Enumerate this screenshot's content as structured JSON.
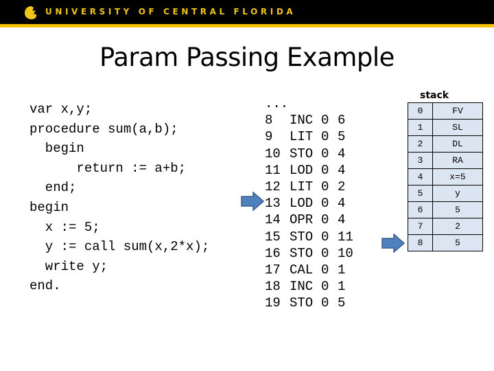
{
  "header": {
    "brand": "UNIVERSITY OF CENTRAL FLORIDA",
    "logo_icon": "pegasus-logo-icon",
    "colors": {
      "bar": "#000000",
      "stripe": "#f5c400",
      "text": "#f0c419"
    }
  },
  "slide": {
    "title": "Param Passing Example"
  },
  "source_code": [
    "var x,y;",
    "procedure sum(a,b);",
    "  begin",
    "      return := a+b;",
    "  end;",
    "begin",
    "  x := 5;",
    "  y := call sum(x,2*x);",
    "  write y;",
    "end."
  ],
  "instructions": {
    "ellipsis": "...",
    "rows": [
      {
        "line": "8",
        "op": "INC",
        "l": "0",
        "m": "6"
      },
      {
        "line": "9",
        "op": "LIT",
        "l": "0",
        "m": "5"
      },
      {
        "line": "10",
        "op": "STO",
        "l": "0",
        "m": "4"
      },
      {
        "line": "11",
        "op": "LOD",
        "l": "0",
        "m": "4"
      },
      {
        "line": "12",
        "op": "LIT",
        "l": "0",
        "m": "2"
      },
      {
        "line": "13",
        "op": "LOD",
        "l": "0",
        "m": "4"
      },
      {
        "line": "14",
        "op": "OPR",
        "l": "0",
        "m": "4"
      },
      {
        "line": "15",
        "op": "STO",
        "l": "0",
        "m": "11"
      },
      {
        "line": "16",
        "op": "STO",
        "l": "0",
        "m": "10"
      },
      {
        "line": "17",
        "op": "CAL",
        "l": "0",
        "m": "1"
      },
      {
        "line": "18",
        "op": "INC",
        "l": "0",
        "m": "1"
      },
      {
        "line": "19",
        "op": "STO",
        "l": "0",
        "m": "5"
      }
    ],
    "current_line": "13"
  },
  "stack": {
    "label": "stack",
    "rows": [
      {
        "index": "0",
        "value": "FV"
      },
      {
        "index": "1",
        "value": "SL"
      },
      {
        "index": "2",
        "value": "DL"
      },
      {
        "index": "3",
        "value": "RA"
      },
      {
        "index": "4",
        "value": "x=5"
      },
      {
        "index": "5",
        "value": "y"
      },
      {
        "index": "6",
        "value": "5"
      },
      {
        "index": "7",
        "value": "2"
      },
      {
        "index": "8",
        "value": "5"
      }
    ],
    "stack_pointer_index": "8",
    "cell_color": "#dce6f2"
  },
  "arrow_color": "#4f81bd"
}
